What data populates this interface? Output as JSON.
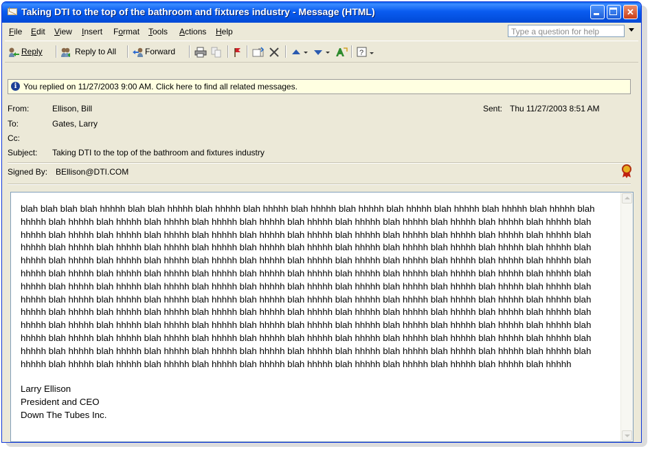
{
  "window": {
    "title": "Taking DTI to the top of the bathroom and fixtures industry - Message (HTML)"
  },
  "menu": {
    "items": [
      {
        "label": "File",
        "u": "F",
        "rest": "ile"
      },
      {
        "label": "Edit",
        "u": "E",
        "rest": "dit"
      },
      {
        "label": "View",
        "u": "V",
        "rest": "iew"
      },
      {
        "label": "Insert",
        "u": "I",
        "rest": "nsert"
      },
      {
        "label": "Format",
        "pre": "F",
        "u": "o",
        "rest": "rmat"
      },
      {
        "label": "Tools",
        "u": "T",
        "rest": "ools"
      },
      {
        "label": "Actions",
        "u": "A",
        "rest": "ctions"
      },
      {
        "label": "Help",
        "u": "H",
        "rest": "elp"
      }
    ],
    "help_placeholder": "Type a question for help"
  },
  "toolbar": {
    "reply": "Reply",
    "reply_all": "Reply to All",
    "forward": "Forward"
  },
  "infobar": {
    "text": "You replied on 11/27/2003 9:00 AM. Click here to find all related messages."
  },
  "header": {
    "from_label": "From:",
    "from": "Ellison, Bill",
    "to_label": "To:",
    "to": "Gates, Larry",
    "cc_label": "Cc:",
    "cc": "",
    "subject_label": "Subject:",
    "subject": "Taking DTI to the top of the bathroom and fixtures industry",
    "sent_label": "Sent:",
    "sent": "Thu 11/27/2003 8:51 AM",
    "signed_label": "Signed By:",
    "signed": "BEllison@DTI.COM"
  },
  "message": {
    "body": "blah blah blah blah hhhhh blah blah hhhhh blah hhhhh blah hhhhh blah hhhhh blah hhhhh blah hhhhh blah hhhhh blah hhhhh blah hhhhh blah hhhhh blah hhhhh blah hhhhh blah hhhhh blah hhhhh blah hhhhh blah hhhhh blah hhhhh blah hhhhh blah hhhhh blah hhhhh blah hhhhh blah hhhhh blah hhhhh blah hhhhh blah hhhhh blah hhhhh blah hhhhh blah hhhhh blah hhhhh blah hhhhh blah hhhhh blah hhhhh blah hhhhh blah hhhhh blah hhhhh blah hhhhh blah hhhhh blah hhhhh blah hhhhh blah hhhhh blah hhhhh blah hhhhh blah hhhhh blah hhhhh blah hhhhh blah hhhhh blah hhhhh blah hhhhh blah hhhhh blah hhhhh blah hhhhh blah hhhhh blah hhhhh blah hhhhh blah hhhhh blah hhhhh blah hhhhh blah hhhhh blah hhhhh blah hhhhh blah hhhhh blah hhhhh blah hhhhh blah hhhhh blah hhhhh blah hhhhh blah hhhhh blah hhhhh blah hhhhh blah hhhhh blah hhhhh blah hhhhh blah hhhhh blah hhhhh blah hhhhh blah hhhhh blah hhhhh blah hhhhh blah hhhhh blah hhhhh blah hhhhh blah hhhhh blah hhhhh blah hhhhh blah hhhhh blah hhhhh blah hhhhh blah hhhhh blah hhhhh blah hhhhh blah hhhhh blah hhhhh blah hhhhh blah hhhhh blah hhhhh blah hhhhh blah hhhhh blah hhhhh blah hhhhh blah hhhhh blah hhhhh blah hhhhh blah hhhhh blah hhhhh blah hhhhh blah hhhhh blah hhhhh blah hhhhh blah hhhhh blah hhhhh blah hhhhh blah hhhhh blah hhhhh blah hhhhh blah hhhhh blah hhhhh blah hhhhh blah hhhhh blah hhhhh blah hhhhh blah hhhhh blah hhhhh blah hhhhh blah hhhhh blah hhhhh blah hhhhh blah hhhhh blah hhhhh blah hhhhh blah hhhhh blah hhhhh blah hhhhh blah hhhhh blah hhhhh blah hhhhh blah hhhhh blah hhhhh blah hhhhh blah hhhhh blah hhhhh blah hhhhh blah hhhhh blah hhhhh blah hhhhh blah hhhhh blah hhhhh blah hhhhh blah hhhhh blah hhhhh blah hhhhh blah hhhhh blah hhhhh blah hhhhh",
    "signature": [
      "Larry Ellison",
      "President and CEO",
      "Down The Tubes Inc."
    ]
  },
  "colors": {
    "titlebar": "#0a5cf0",
    "infobar": "#ffffe1",
    "chrome": "#ece9d8"
  }
}
